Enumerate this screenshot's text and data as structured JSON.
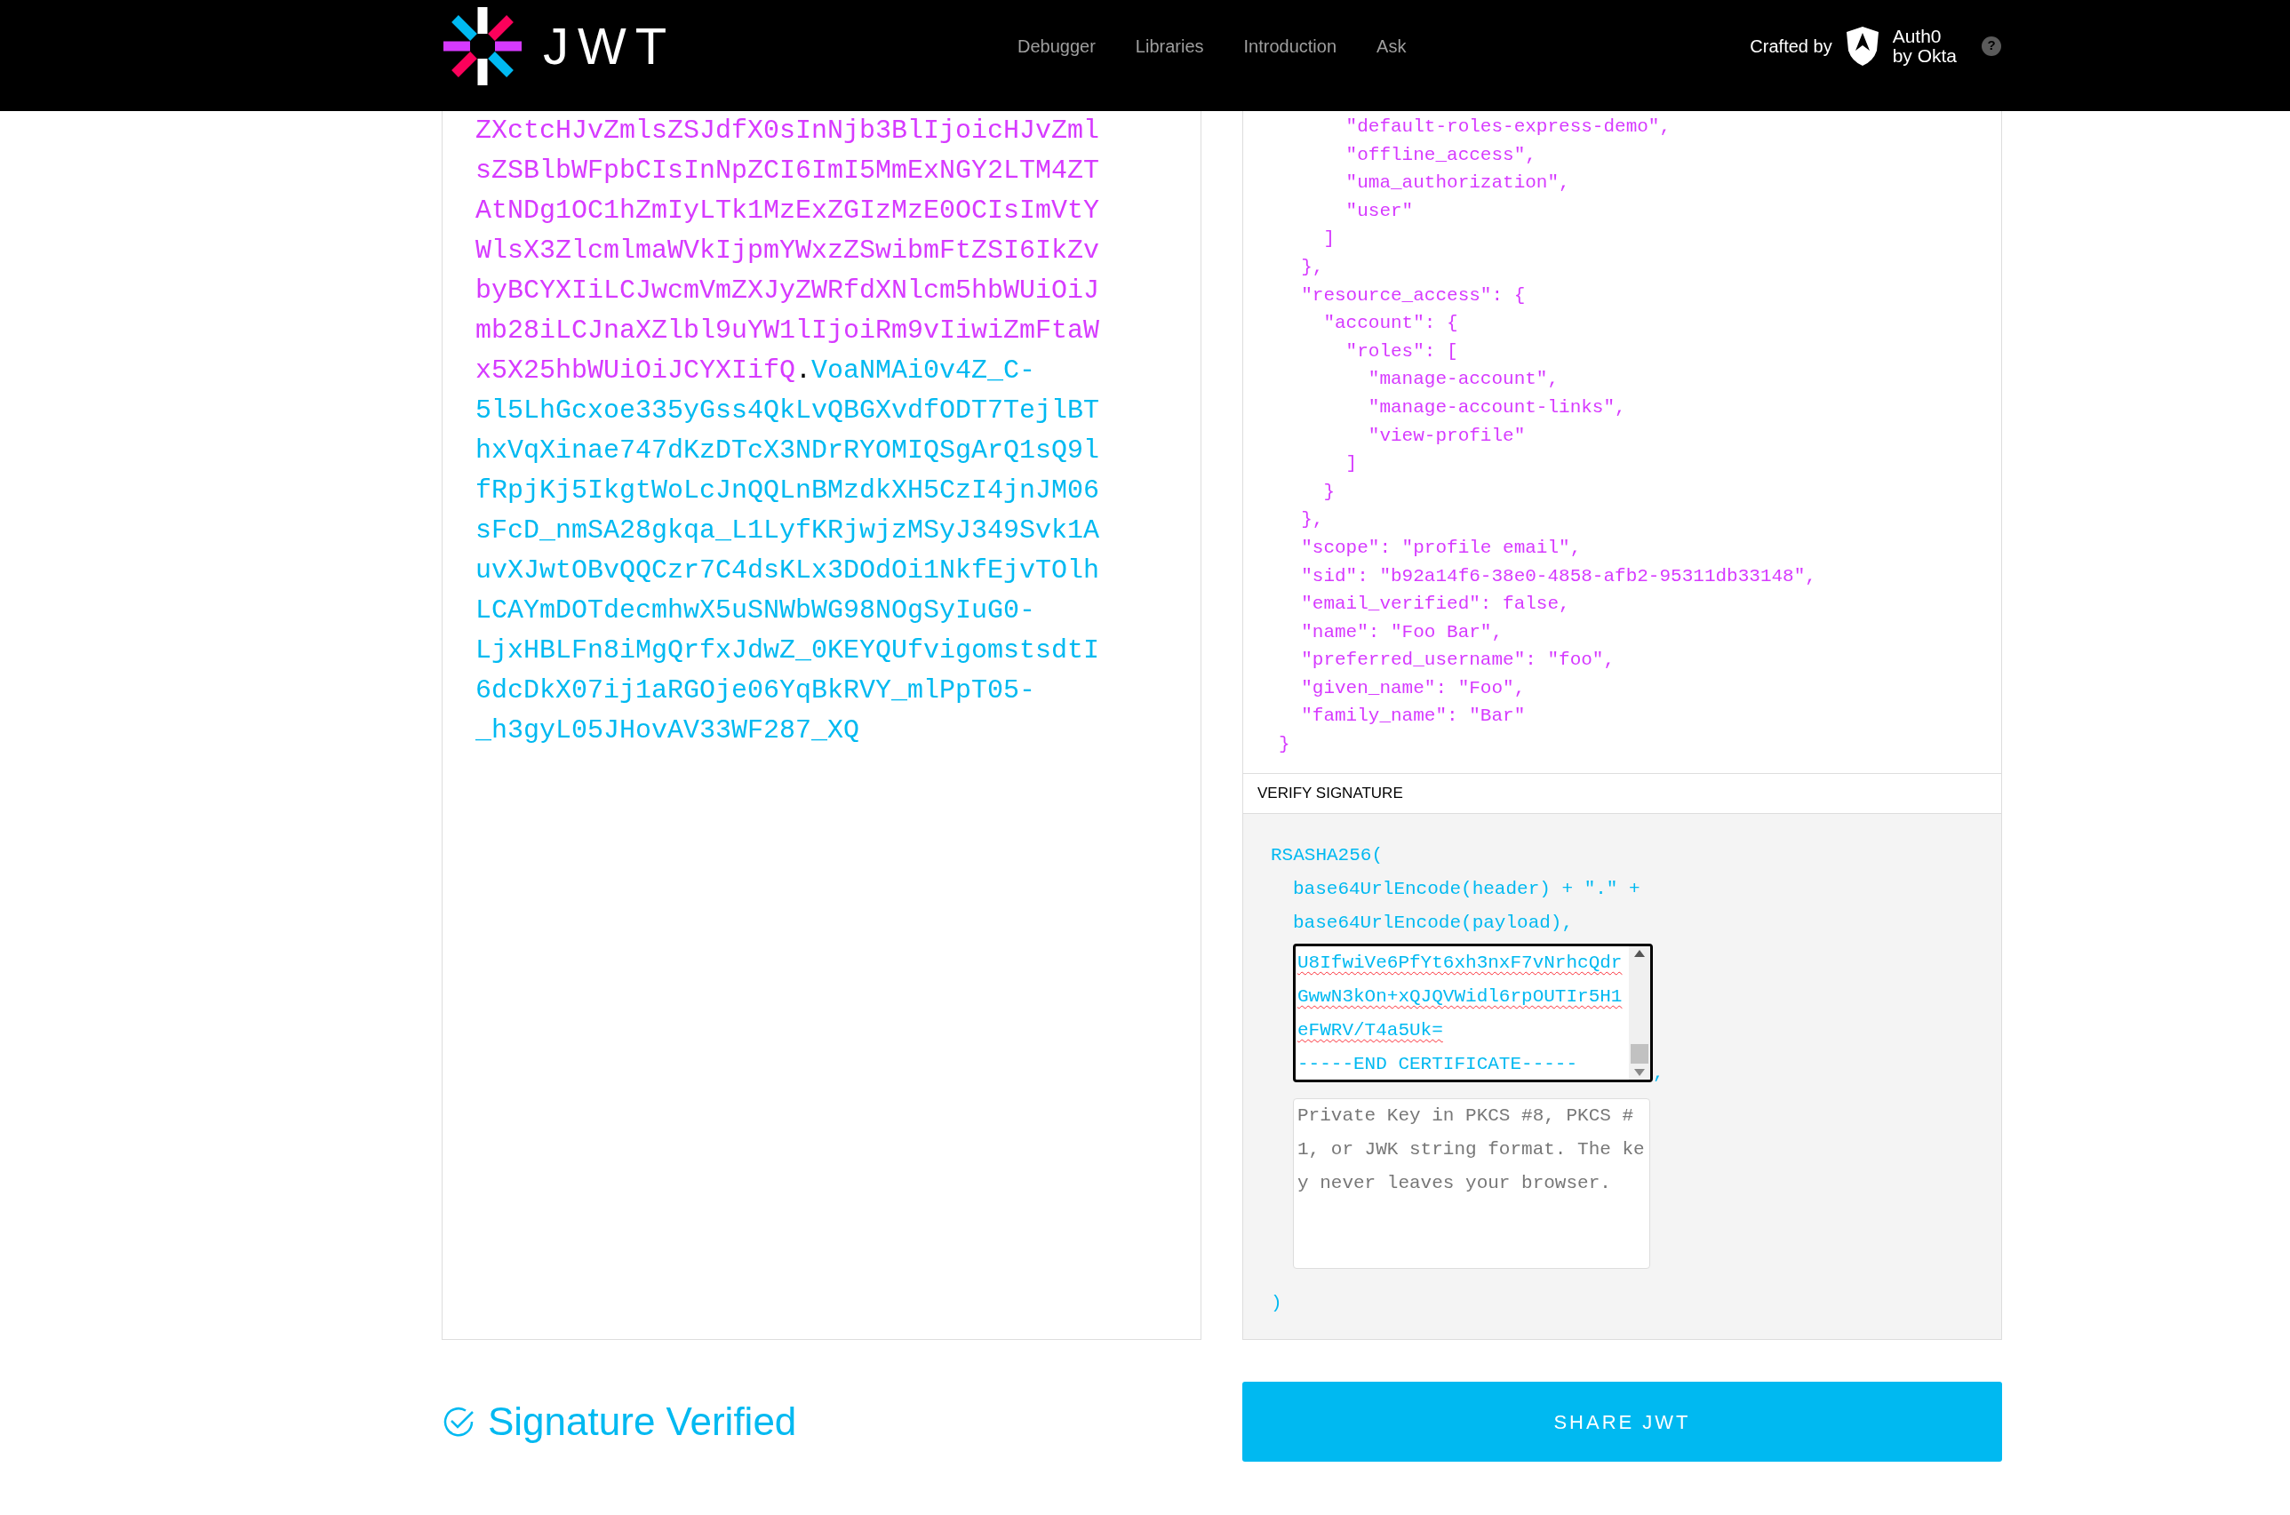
{
  "header": {
    "logo_text": "JWT",
    "nav": [
      "Debugger",
      "Libraries",
      "Introduction",
      "Ask"
    ],
    "crafted_by": "Crafted by",
    "brand_lines": [
      "Auth0",
      "by Okta"
    ],
    "help": "?"
  },
  "encoded_token": {
    "lines": [
      [
        {
          "kind": "payload",
          "text": "ZXctcHJvZmlsZSJdfX0sInNjb3BlIjoicHJvZml"
        }
      ],
      [
        {
          "kind": "payload",
          "text": "sZSBlbWFpbCIsInNpZCI6ImI5MmExNGY2LTM4ZT"
        }
      ],
      [
        {
          "kind": "payload",
          "text": "AtNDg1OC1hZmIyLTk1MzExZGIzMzE0OCIsImVtY"
        }
      ],
      [
        {
          "kind": "payload",
          "text": "WlsX3ZlcmlmaWVkIjpmYWxzZSwibmFtZSI6IkZv"
        }
      ],
      [
        {
          "kind": "payload",
          "text": "byBCYXIiLCJwcmVmZXJyZWRfdXNlcm5hbWUiOiJ"
        }
      ],
      [
        {
          "kind": "payload",
          "text": "mb28iLCJnaXZlbl9uYW1lIjoiRm9vIiwiZmFtaW"
        }
      ],
      [
        {
          "kind": "payload",
          "text": "x5X25hbWUiOiJCYXIifQ"
        },
        {
          "kind": "dot",
          "text": "."
        },
        {
          "kind": "signature",
          "text": "VoaNMAi0v4Z_C-"
        }
      ],
      [
        {
          "kind": "signature",
          "text": "5l5LhGcxoe335yGss4QkLvQBGXvdfODT7TejlBT"
        }
      ],
      [
        {
          "kind": "signature",
          "text": "hxVqXinae747dKzDTcX3NDrRYOMIQSgArQ1sQ9l"
        }
      ],
      [
        {
          "kind": "signature",
          "text": "fRpjKj5IkgtWoLcJnQQLnBMzdkXH5CzI4jnJM06"
        }
      ],
      [
        {
          "kind": "signature",
          "text": "sFcD_nmSA28gkqa_L1LyfKRjwjzMSyJ349Svk1A"
        }
      ],
      [
        {
          "kind": "signature",
          "text": "uvXJwtOBvQQCzr7C4dsKLx3DOdOi1NkfEjvTOlh"
        }
      ],
      [
        {
          "kind": "signature",
          "text": "LCAYmDOTdecmhwX5uSNWbWG98NOgSyIuG0-"
        }
      ],
      [
        {
          "kind": "signature",
          "text": "LjxHBLFn8iMgQrfxJdwZ_0KEYQUfvigomstsdtI"
        }
      ],
      [
        {
          "kind": "signature",
          "text": "6dcDkX07ij1aRGOje06YqBkRVY_mlPpT05-"
        }
      ],
      [
        {
          "kind": "signature",
          "text": "_h3gyL05JHovAV33WF287_XQ"
        }
      ]
    ]
  },
  "payload_json": {
    "lines": [
      "      \"default-roles-express-demo\",",
      "      \"offline_access\",",
      "      \"uma_authorization\",",
      "      \"user\"",
      "    ]",
      "  },",
      "  \"resource_access\": {",
      "    \"account\": {",
      "      \"roles\": [",
      "        \"manage-account\",",
      "        \"manage-account-links\",",
      "        \"view-profile\"",
      "      ]",
      "    }",
      "  },",
      "  \"scope\": \"profile email\",",
      "  \"sid\": \"b92a14f6-38e0-4858-afb2-95311db33148\",",
      "  \"email_verified\": false,",
      "  \"name\": \"Foo Bar\",",
      "  \"preferred_username\": \"foo\",",
      "  \"given_name\": \"Foo\",",
      "  \"family_name\": \"Bar\"",
      "}"
    ]
  },
  "verify_signature": {
    "title": "VERIFY SIGNATURE",
    "open": "RSASHA256(",
    "args": [
      "base64UrlEncode(header) + \".\" +",
      "base64UrlEncode(payload),"
    ],
    "public_key_lines": [
      {
        "text": "U8IfwiVe6PfYt6xh3nxF7vNrhcQdr",
        "misspelled": true
      },
      {
        "text": "GwwN3kOn+xQJQVWidl6rpOUTIr5H1",
        "misspelled": true
      },
      {
        "text": "eFWRV/T4a5Uk=",
        "misspelled": true
      },
      {
        "text": "-----END CERTIFICATE-----",
        "misspelled": false
      }
    ],
    "separator": ",",
    "private_key": {
      "placeholder": "Private Key in PKCS #8, PKCS #1, or JWK string format. The key never leaves your browser."
    },
    "close": ")"
  },
  "status": {
    "text": "Signature Verified",
    "verified": true
  },
  "share_button": "SHARE JWT"
}
